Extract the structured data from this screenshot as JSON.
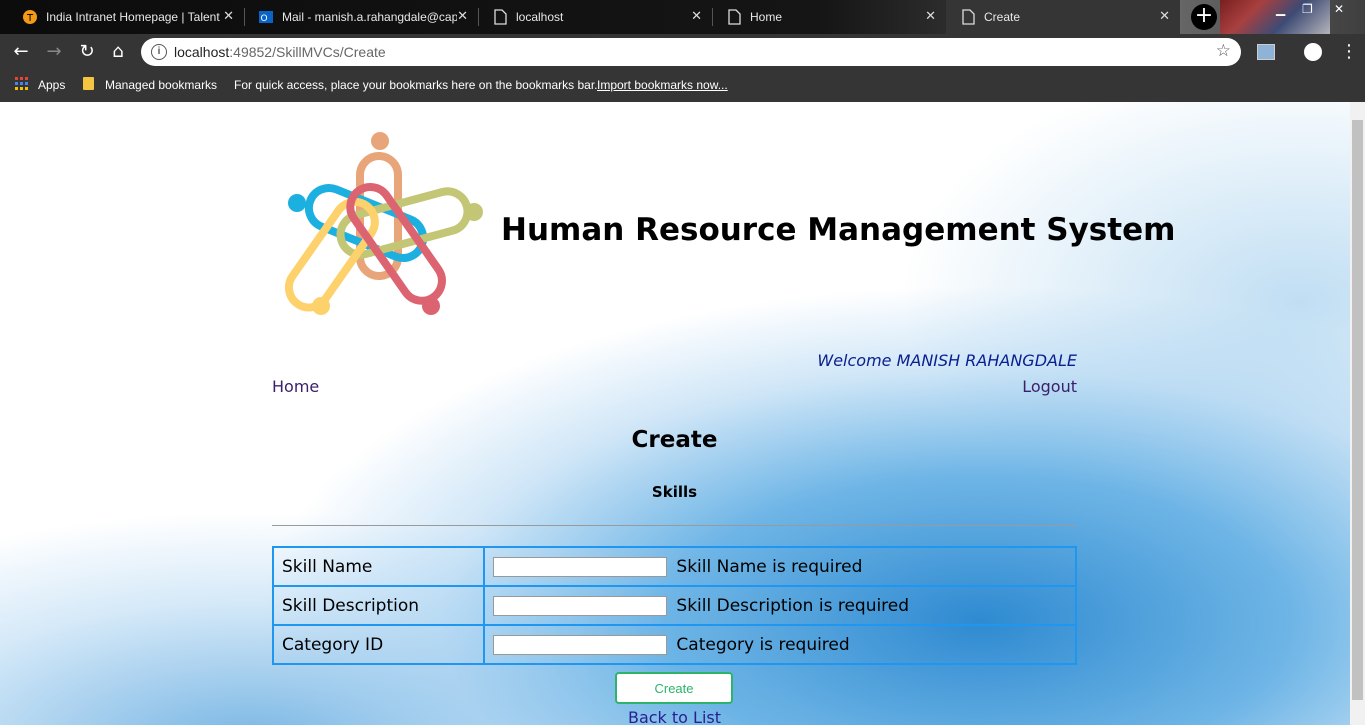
{
  "browser": {
    "tabs": [
      {
        "label": "India Intranet Homepage | Talent",
        "icon": "talent-favicon"
      },
      {
        "label": "Mail - manish.a.rahangdale@capgemini.com",
        "icon": "outlook-favicon"
      },
      {
        "label": "localhost",
        "icon": "page-icon"
      },
      {
        "label": "Home",
        "icon": "page-icon"
      },
      {
        "label": "Create",
        "icon": "page-icon"
      }
    ],
    "url_host": "localhost",
    "url_rest": ":49852/SkillMVCs/Create",
    "bookmarks": {
      "apps": "Apps",
      "managed": "Managed bookmarks",
      "hint": "For quick access, place your bookmarks here on the bookmarks bar.",
      "import_link": "Import bookmarks now..."
    }
  },
  "header": {
    "app_title": "Human Resource Management System",
    "welcome": "Welcome MANISH RAHANGDALE"
  },
  "nav": {
    "home": "Home",
    "logout": "Logout"
  },
  "main": {
    "page_title": "Create",
    "section_title": "Skills",
    "fields": [
      {
        "label": "Skill Name",
        "value": "",
        "validation": "Skill Name is required"
      },
      {
        "label": "Skill Description",
        "value": "",
        "validation": "Skill Description is required"
      },
      {
        "label": "Category ID",
        "value": "",
        "validation": "Category is required"
      }
    ],
    "create_button": "Create",
    "back_link": "Back to List"
  },
  "colors": {
    "table_border": "#1f96f0",
    "create_button": "#2db36a",
    "welcome_text": "#0a1f8f",
    "nav_link": "#3a1f6b"
  }
}
